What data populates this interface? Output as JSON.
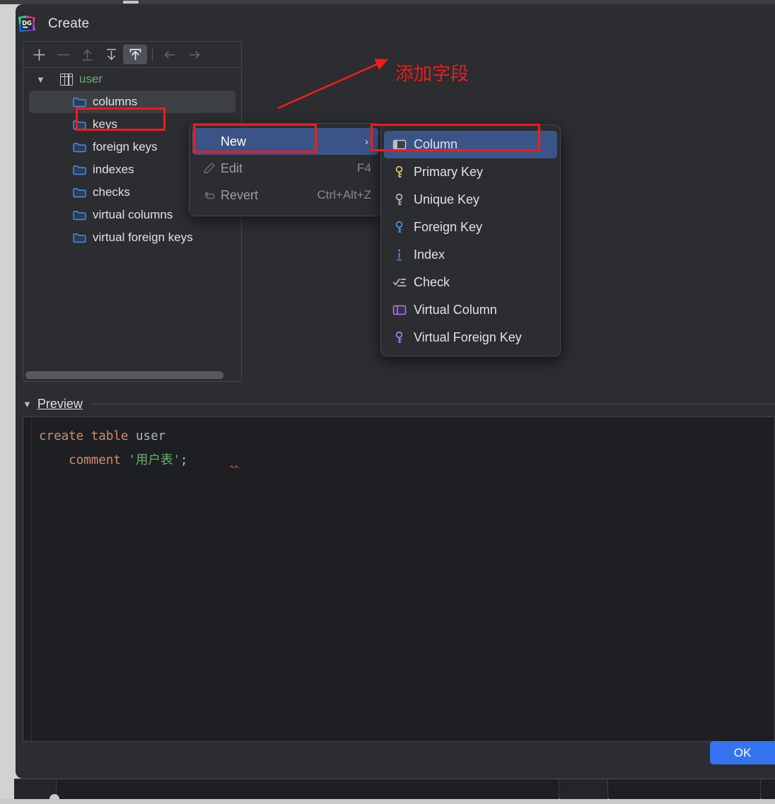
{
  "window": {
    "title": "Create",
    "logo_icon": "datagrip-logo-icon"
  },
  "toolbar": {
    "buttons": [
      {
        "name": "add-button",
        "glyph": "+",
        "state": "enabled"
      },
      {
        "name": "remove-button",
        "glyph": "−",
        "state": "disabled"
      },
      {
        "name": "move-up-button",
        "glyph": "↑",
        "state": "disabled"
      },
      {
        "name": "move-down-button",
        "glyph": "↓",
        "state": "enabled"
      },
      {
        "name": "move-to-top-button",
        "glyph": "⇧",
        "state": "active"
      },
      {
        "name": "back-button",
        "glyph": "←",
        "state": "disabled"
      },
      {
        "name": "forward-button",
        "glyph": "→",
        "state": "disabled"
      }
    ]
  },
  "tree": {
    "root": {
      "label": "user",
      "icon": "table-icon",
      "expanded": true
    },
    "children": [
      {
        "label": "columns",
        "icon": "folder-icon",
        "selected": true
      },
      {
        "label": "keys",
        "icon": "folder-icon",
        "selected": false
      },
      {
        "label": "foreign keys",
        "icon": "folder-icon",
        "selected": false
      },
      {
        "label": "indexes",
        "icon": "folder-icon",
        "selected": false
      },
      {
        "label": "checks",
        "icon": "folder-icon",
        "selected": false
      },
      {
        "label": "virtual columns",
        "icon": "folder-icon",
        "selected": false
      },
      {
        "label": "virtual foreign keys",
        "icon": "folder-icon",
        "selected": false
      }
    ]
  },
  "context_menu": {
    "items": [
      {
        "label": "New",
        "icon": "",
        "shortcut": "",
        "submenu_arrow": "›",
        "highlighted": true,
        "enabled": true
      },
      {
        "label": "Edit",
        "icon": "pencil-icon",
        "shortcut": "F4",
        "submenu_arrow": "",
        "highlighted": false,
        "enabled": false
      },
      {
        "label": "Revert",
        "icon": "undo-icon",
        "shortcut": "Ctrl+Alt+Z",
        "submenu_arrow": "",
        "highlighted": false,
        "enabled": false
      }
    ]
  },
  "submenu": {
    "items": [
      {
        "label": "Column",
        "icon": "column-icon",
        "highlighted": true
      },
      {
        "label": "Primary Key",
        "icon": "primary-key-icon",
        "highlighted": false
      },
      {
        "label": "Unique Key",
        "icon": "unique-key-icon",
        "highlighted": false
      },
      {
        "label": "Foreign Key",
        "icon": "foreign-key-icon",
        "highlighted": false
      },
      {
        "label": "Index",
        "icon": "index-icon",
        "highlighted": false
      },
      {
        "label": "Check",
        "icon": "check-icon",
        "highlighted": false
      },
      {
        "label": "Virtual Column",
        "icon": "virtual-column-icon",
        "highlighted": false
      },
      {
        "label": "Virtual Foreign Key",
        "icon": "virtual-foreign-key-icon",
        "highlighted": false
      }
    ]
  },
  "annotation": {
    "text": "添加字段",
    "color": "#ee1c1c"
  },
  "preview": {
    "label": "Preview",
    "expanded": true,
    "code": {
      "line1_kw1": "create",
      "line1_kw2": "table",
      "line1_ident": "user",
      "line2_kw": "comment",
      "line2_str": "'用户表'",
      "line2_punct": ";"
    }
  },
  "footer": {
    "ok_label": "OK",
    "accent_color": "#3574f0"
  }
}
